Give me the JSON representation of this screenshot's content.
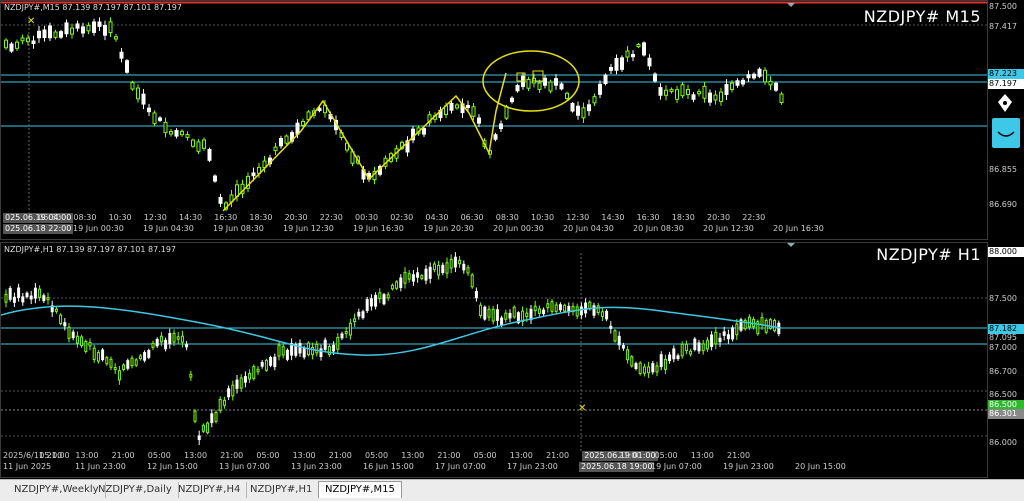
{
  "m15": {
    "header": "NZDJPY#,M15  87.139 87.197 87.101 87.197",
    "symbol_label": "NZDJPY# M15",
    "price_ticks": [
      "87.500",
      "87.417",
      "87.223",
      "87.197",
      "86.855",
      "86.690"
    ],
    "bid_tag": "87.223",
    "ask_tag": "87.197",
    "time_labels": [
      "025.06.19 04:00",
      "06:30",
      "08:30",
      "10:30",
      "12:30",
      "14:30",
      "16:30",
      "18:30",
      "20:30",
      "22:30",
      "00:30",
      "02:30",
      "04:30",
      "06:30",
      "08:30",
      "10:30",
      "12:30",
      "14:30",
      "16:30",
      "18:30",
      "20:30",
      "22:30"
    ],
    "date_labels": [
      "025.06.18 22:00",
      "19 Jun 00:30",
      "19 Jun 04:30",
      "19 Jun 08:30",
      "19 Jun 12:30",
      "19 Jun 16:30",
      "19 Jun 20:30",
      "20 Jun 00:30",
      "20 Jun 04:30",
      "20 Jun 08:30",
      "20 Jun 12:30",
      "20 Jun 16:30"
    ]
  },
  "h1": {
    "header": "NZDJPY#,H1  87.139 87.197 87.101 87.197",
    "symbol_label": "NZDJPY# H1",
    "price_ticks": [
      "88.000",
      "87.500",
      "87.095",
      "87.000",
      "86.700",
      "86.500",
      "86.000"
    ],
    "bid_tag": "87.182",
    "green_tag": "86.500",
    "gray_tag": "86.301",
    "time_labels": [
      "2025/6/11 21:00",
      "05:00",
      "13:00",
      "21:00",
      "05:00",
      "13:00",
      "21:00",
      "05:00",
      "13:00",
      "21:00",
      "05:00",
      "13:00",
      "21:00",
      "05:00",
      "13:00",
      "21:00",
      "2025.06.19 01:00",
      "21:00",
      "05:00",
      "13:00",
      "21:00"
    ],
    "date_labels": [
      "11 Jun 2025",
      "11 Jun 23:00",
      "12 Jun 15:00",
      "13 Jun 07:00",
      "13 Jun 23:00",
      "16 Jun 15:00",
      "17 Jun 07:00",
      "17 Jun 23:00",
      "2025.06.18 19:00",
      "19 Jun 07:00",
      "19 Jun 23:00",
      "20 Jun 15:00"
    ]
  },
  "tabs": [
    "NZDJPY#,Weekly",
    "NZDJPY#,Daily",
    "NZDJPY#,H4",
    "NZDJPY#,H1",
    "NZDJPY#,M15"
  ],
  "active_tab": "NZDJPY#,M15",
  "colors": {
    "bull": "#7CFC00",
    "bear": "#ffffff",
    "ma": "#3cc8e6",
    "hline": "#3cc8e6",
    "annotation": "#e8e000",
    "sell_tag": "#00e5ff"
  }
}
